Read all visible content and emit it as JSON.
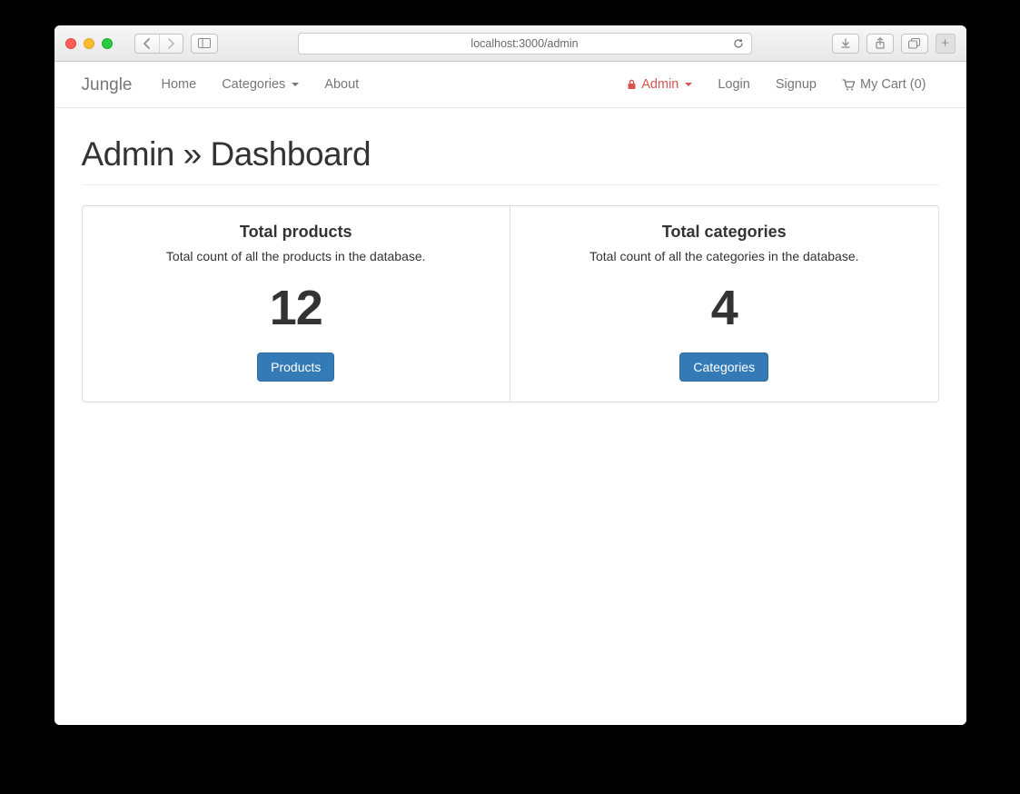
{
  "browser": {
    "url_display": "localhost:3000/admin"
  },
  "navbar": {
    "brand": "Jungle",
    "left": [
      {
        "label": "Home"
      },
      {
        "label": "Categories",
        "dropdown": true
      },
      {
        "label": "About"
      }
    ],
    "right": {
      "admin_label": "Admin",
      "login_label": "Login",
      "signup_label": "Signup",
      "cart_label": "My Cart (0)"
    }
  },
  "page": {
    "heading": "Admin » Dashboard",
    "cards": {
      "products": {
        "title": "Total products",
        "description": "Total count of all the products in the database.",
        "value": "12",
        "button": "Products"
      },
      "categories": {
        "title": "Total categories",
        "description": "Total count of all the categories in the database.",
        "value": "4",
        "button": "Categories"
      }
    }
  }
}
